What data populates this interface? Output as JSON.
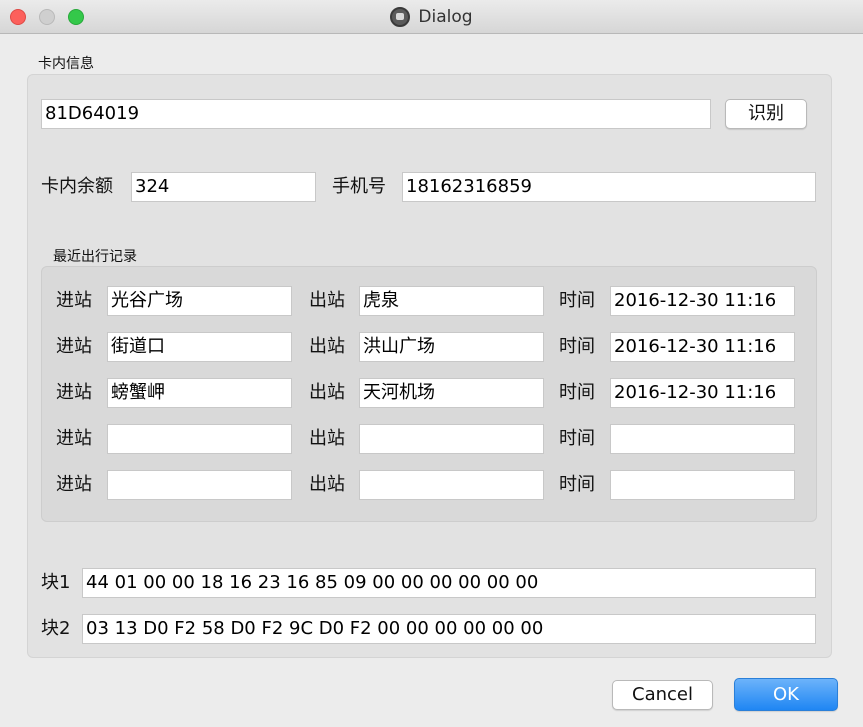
{
  "window": {
    "title": "Dialog"
  },
  "card": {
    "group_label": "卡内信息",
    "card_id": "81D64019",
    "identify_button": "识别",
    "balance_label": "卡内余额",
    "balance_value": "324",
    "phone_label": "手机号",
    "phone_value": "18162316859"
  },
  "trips": {
    "group_label": "最近出行记录",
    "entry_label": "进站",
    "exit_label": "出站",
    "time_label": "时间",
    "rows": [
      {
        "entry": "光谷广场",
        "exit": "虎泉",
        "time": "2016-12-30 11:16"
      },
      {
        "entry": "街道口",
        "exit": "洪山广场",
        "time": "2016-12-30 11:16"
      },
      {
        "entry": "螃蟹岬",
        "exit": "天河机场",
        "time": "2016-12-30 11:16"
      },
      {
        "entry": "",
        "exit": "",
        "time": ""
      },
      {
        "entry": "",
        "exit": "",
        "time": ""
      }
    ]
  },
  "blocks": {
    "block1_label": "块1",
    "block1_value": "44 01 00 00 18 16 23 16 85 09 00 00 00 00 00 00",
    "block2_label": "块2",
    "block2_value": "03 13 D0 F2 58 D0 F2 9C D0 F2 00 00 00 00 00 00"
  },
  "buttons": {
    "cancel": "Cancel",
    "ok": "OK"
  }
}
